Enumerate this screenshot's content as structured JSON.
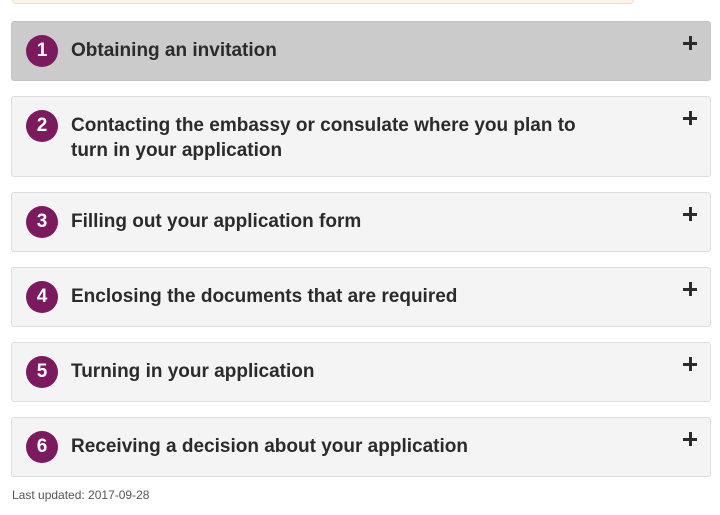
{
  "steps": [
    {
      "number": "1",
      "title": "Obtaining an invitation"
    },
    {
      "number": "2",
      "title": "Contacting the embassy or consulate where you plan to turn in your application"
    },
    {
      "number": "3",
      "title": "Filling out your application form"
    },
    {
      "number": "4",
      "title": "Enclosing the documents that are required"
    },
    {
      "number": "5",
      "title": "Turning in your application"
    },
    {
      "number": "6",
      "title": "Receiving a decision about your application"
    }
  ],
  "footer": {
    "last_updated": "Last updated: 2017-09-28"
  },
  "colors": {
    "accent": "#7b1a5e",
    "active_step_bg": "#cbcbcb",
    "step_bg": "#f4f4f4"
  },
  "icons": {
    "expand": "plus-icon"
  }
}
